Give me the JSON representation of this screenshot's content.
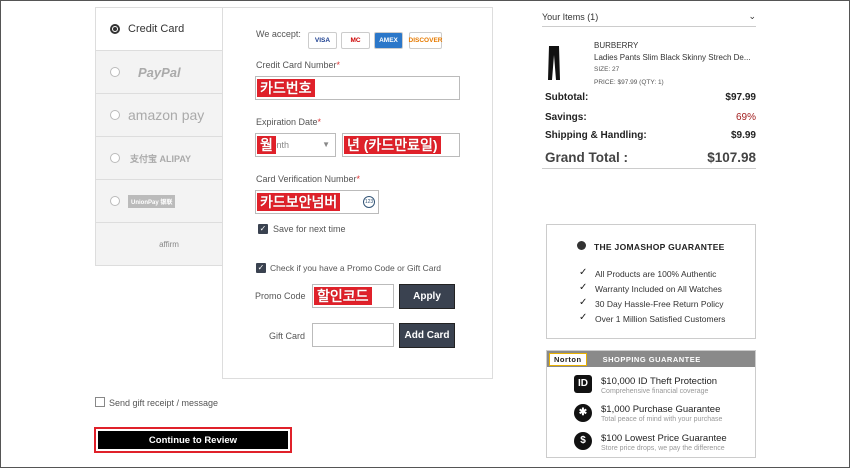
{
  "payment_methods": [
    {
      "label": "Credit Card",
      "active": true
    },
    {
      "label": "PayPal"
    },
    {
      "label": "amazon pay"
    },
    {
      "label": "支付宝 ALIPAY"
    },
    {
      "label": "UnionPay 银联"
    },
    {
      "label": "affirm"
    }
  ],
  "form": {
    "we_accept": "We accept:",
    "card_logos": [
      "VISA",
      "MC",
      "AMEX",
      "DISCOVER"
    ],
    "card_number_label": "Credit Card Number",
    "card_number_overlay": "카드번호",
    "expiration_label": "Expiration Date",
    "month_placeholder": "Month",
    "month_overlay": "월",
    "year_overlay": "년 (카드만료일)",
    "cvv_label": "Card Verification Number",
    "cvv_overlay": "카드보안넘버",
    "save_label": "Save for next time",
    "promo_check_label": "Check if you have a Promo Code or Gift Card",
    "promo_label": "Promo Code",
    "promo_overlay": "할인코드",
    "apply_button": "Apply",
    "gift_label": "Gift Card",
    "add_card_button": "Add Card",
    "required_mark": "*"
  },
  "gift_receipt_label": "Send gift receipt / message",
  "continue_button": "Continue to Review",
  "summary": {
    "items_header": "Your Items (1)",
    "item_brand": "BURBERRY",
    "item_name": "Ladies Pants Slim Black Skinny Strech De...",
    "item_size": "SIZE: 27",
    "item_price": "PRICE: $97.99 (QTY: 1)",
    "subtotal_label": "Subtotal:",
    "subtotal_value": "$97.99",
    "savings_label": "Savings:",
    "savings_value": "69%",
    "shipping_label": "Shipping & Handling:",
    "shipping_value": "$9.99",
    "grand_label": "Grand Total :",
    "grand_value": "$107.98"
  },
  "guarantee": {
    "title": "THE JOMASHOP GUARANTEE",
    "items": [
      "All Products are 100% Authentic",
      "Warranty Included on All Watches",
      "30 Day Hassle-Free Return Policy",
      "Over 1 Million Satisfied Customers"
    ]
  },
  "norton": {
    "logo": "Norton",
    "header": "SHOPPING GUARANTEE",
    "items": [
      {
        "title": "$10,000 ID Theft Protection",
        "sub": "Comprehensive financial coverage"
      },
      {
        "title": "$1,000 Purchase Guarantee",
        "sub": "Total peace of mind with your purchase"
      },
      {
        "title": "$100 Lowest Price Guarantee",
        "sub": "Store price drops, we pay the difference"
      }
    ]
  },
  "colors": {
    "savings": "#a32020",
    "button": "#3a4250",
    "highlight": "#e0212a"
  }
}
